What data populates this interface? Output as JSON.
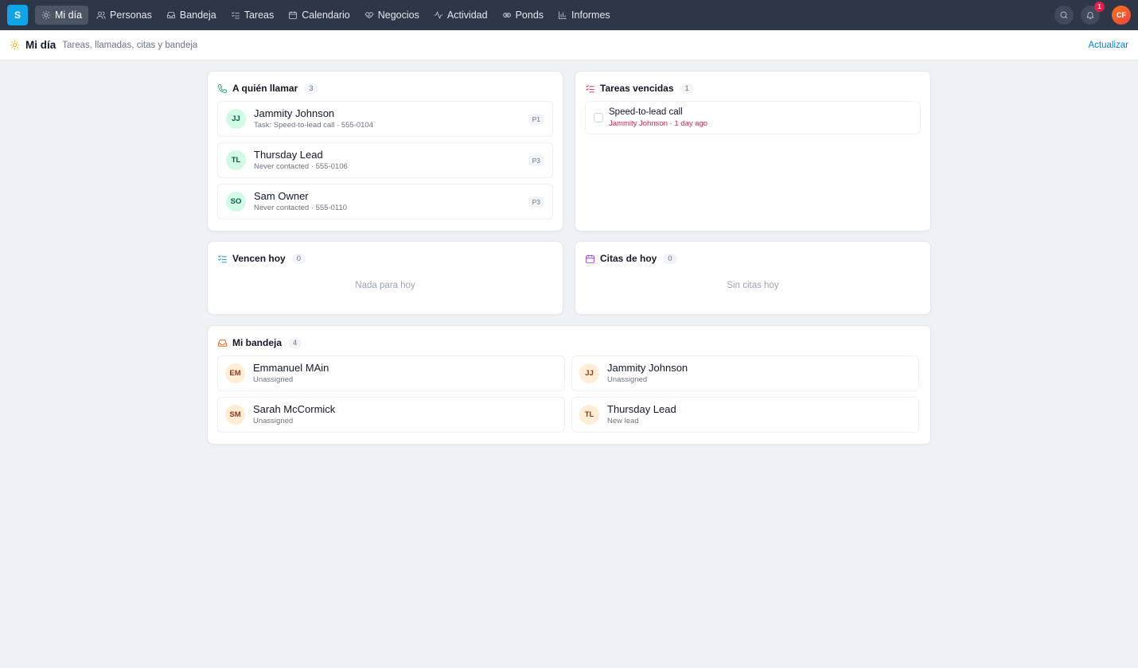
{
  "app": {
    "logo_letter": "S"
  },
  "nav": {
    "items": [
      {
        "label": "Mi día",
        "icon": "sun-icon",
        "active": true
      },
      {
        "label": "Personas",
        "icon": "users-icon"
      },
      {
        "label": "Bandeja",
        "icon": "inbox-icon"
      },
      {
        "label": "Tareas",
        "icon": "list-check-icon"
      },
      {
        "label": "Calendario",
        "icon": "calendar-icon"
      },
      {
        "label": "Negocios",
        "icon": "handshake-icon"
      },
      {
        "label": "Actividad",
        "icon": "activity-icon"
      },
      {
        "label": "Ponds",
        "icon": "pond-icon"
      },
      {
        "label": "Informes",
        "icon": "bar-chart-icon"
      }
    ],
    "notification_count": "1",
    "user_initials": "CF"
  },
  "header": {
    "title": "Mi día",
    "subtitle": "Tareas, llamadas, citas y bandeja",
    "refresh_label": "Actualizar"
  },
  "calls": {
    "title": "A quién llamar",
    "count": "3",
    "items": [
      {
        "initials": "JJ",
        "name": "Jammity Johnson",
        "meta": "Task: Speed-to-lead call · 555-0104",
        "priority": "P1"
      },
      {
        "initials": "TL",
        "name": "Thursday Lead",
        "meta": "Never contacted · 555-0106",
        "priority": "P3"
      },
      {
        "initials": "SO",
        "name": "Sam Owner",
        "meta": "Never contacted · 555-0110",
        "priority": "P3"
      }
    ]
  },
  "overdue": {
    "title": "Tareas vencidas",
    "count": "1",
    "items": [
      {
        "name": "Speed-to-lead call",
        "meta": "Jammity Johnson · 1 day ago"
      }
    ]
  },
  "due_today": {
    "title": "Vencen hoy",
    "count": "0",
    "empty": "Nada para hoy"
  },
  "appointments": {
    "title": "Citas de hoy",
    "count": "0",
    "empty": "Sin citas hoy"
  },
  "inbox": {
    "title": "Mi bandeja",
    "count": "4",
    "items": [
      {
        "initials": "EM",
        "name": "Emmanuel MAin",
        "meta": "Unassigned"
      },
      {
        "initials": "JJ",
        "name": "Jammity Johnson",
        "meta": "Unassigned"
      },
      {
        "initials": "SM",
        "name": "Sarah McCormick",
        "meta": "Unassigned"
      },
      {
        "initials": "TL",
        "name": "Thursday Lead",
        "meta": "New lead"
      }
    ]
  },
  "colors": {
    "nav_bg": "#2d3748",
    "accent": "#0ea5e9",
    "link": "#0284c7",
    "overdue": "#e11d48",
    "phone_icon": "#059669",
    "overdue_icon": "#e11d48",
    "due_icon": "#0284c7",
    "calendar_icon": "#9333ea",
    "inbox_icon": "#ea580c"
  }
}
